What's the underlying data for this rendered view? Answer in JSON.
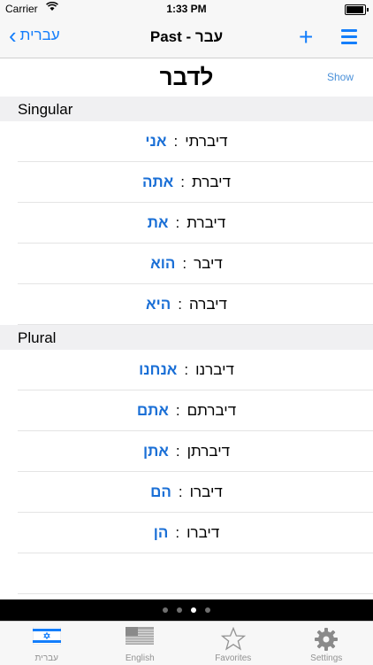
{
  "status_bar": {
    "carrier": "Carrier",
    "time": "1:33 PM",
    "battery_level": 0.95
  },
  "nav": {
    "back_label": "עברית",
    "title": "Past - עבר",
    "plus_icon": "+"
  },
  "infinitive": "לדבר",
  "show_label": "Show",
  "sections": [
    {
      "header": "Singular",
      "rows": [
        {
          "pronoun": "אני",
          "verb": "דיברתי"
        },
        {
          "pronoun": "אתה",
          "verb": "דיברת"
        },
        {
          "pronoun": "את",
          "verb": "דיברת"
        },
        {
          "pronoun": "הוא",
          "verb": "דיבר"
        },
        {
          "pronoun": "היא",
          "verb": "דיברה"
        }
      ]
    },
    {
      "header": "Plural",
      "rows": [
        {
          "pronoun": "אנחנו",
          "verb": "דיברנו"
        },
        {
          "pronoun": "אתם",
          "verb": "דיברתם"
        },
        {
          "pronoun": "אתן",
          "verb": "דיברתן"
        },
        {
          "pronoun": "הם",
          "verb": "דיברו"
        },
        {
          "pronoun": "הן",
          "verb": "דיברו"
        }
      ]
    }
  ],
  "separator": ":",
  "page_indicator": {
    "count": 4,
    "active": 3
  },
  "tabs": [
    {
      "label": "עברית",
      "icon": "israel-flag-icon",
      "selected": true
    },
    {
      "label": "English",
      "icon": "us-flag-icon",
      "selected": false
    },
    {
      "label": "Favorites",
      "icon": "star-icon",
      "selected": false
    },
    {
      "label": "Settings",
      "icon": "gear-icon",
      "selected": false
    }
  ],
  "colors": {
    "accent": "#147efb",
    "pronoun": "#1a6fd6"
  }
}
